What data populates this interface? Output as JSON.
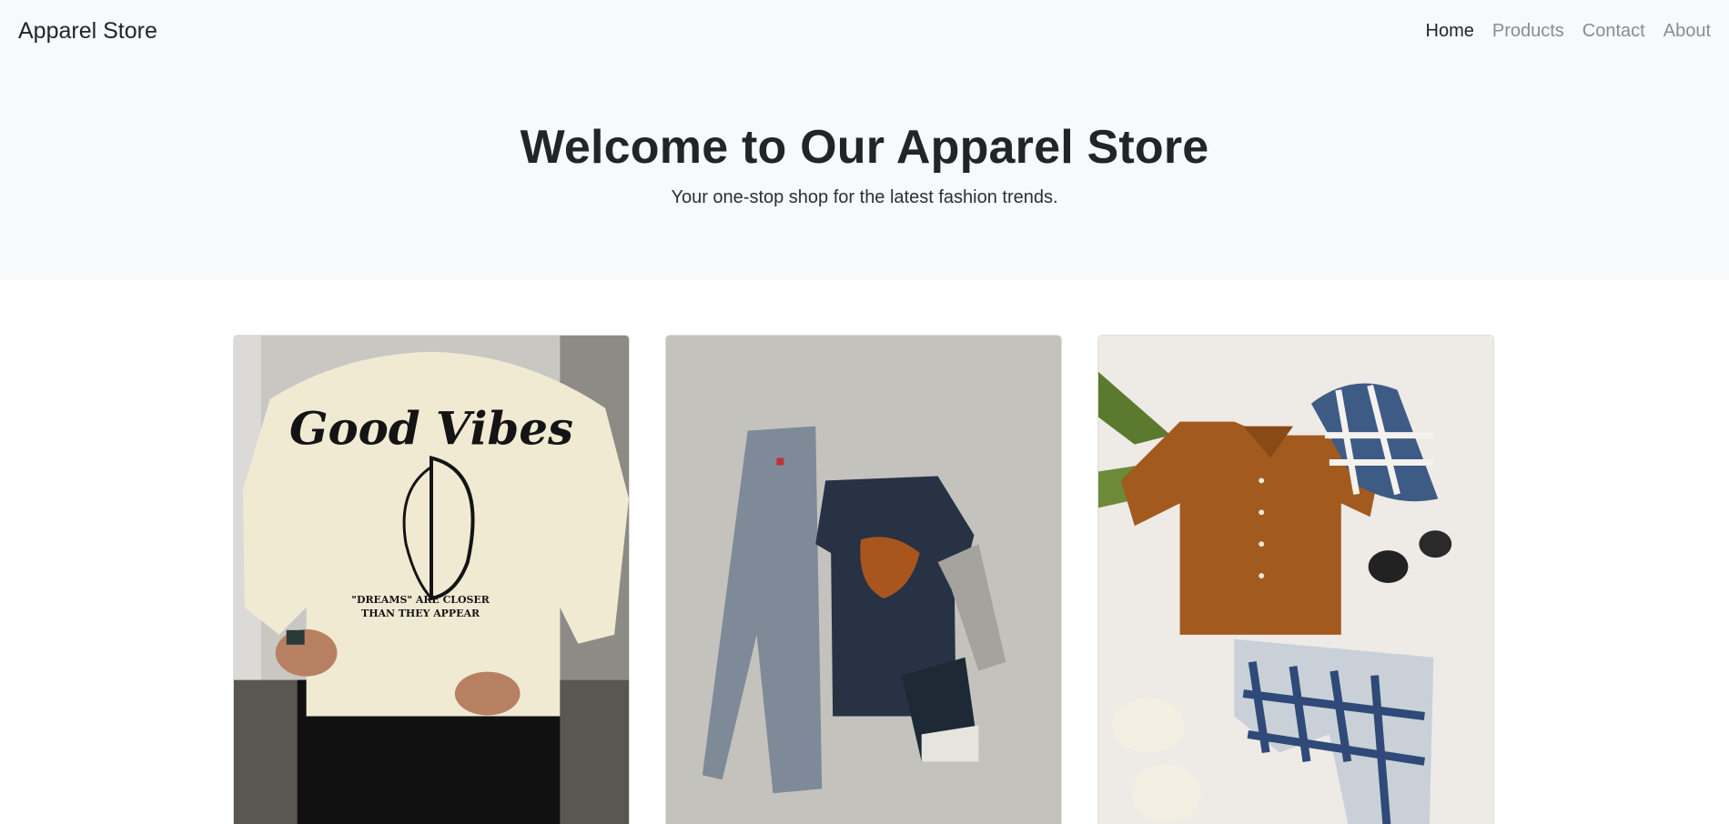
{
  "navbar": {
    "brand": "Apparel Store",
    "links": [
      {
        "label": "Home",
        "active": true
      },
      {
        "label": "Products",
        "active": false
      },
      {
        "label": "Contact",
        "active": false
      },
      {
        "label": "About",
        "active": false
      }
    ]
  },
  "hero": {
    "title": "Welcome to Our Apparel Store",
    "subtitle": "Your one-stop shop for the latest fashion trends."
  },
  "products": [
    {
      "image": "cream-graphic-tshirt-photo",
      "print_line1": "Good Vibes",
      "print_line2": "\"DREAMS\" ARE CLOSER",
      "print_line3": "THAN THEY APPEAR"
    },
    {
      "image": "denim-jeans-and-navy-tee-flatlay-photo"
    },
    {
      "image": "kids-brown-shirt-plaid-shorts-set-photo"
    }
  ]
}
